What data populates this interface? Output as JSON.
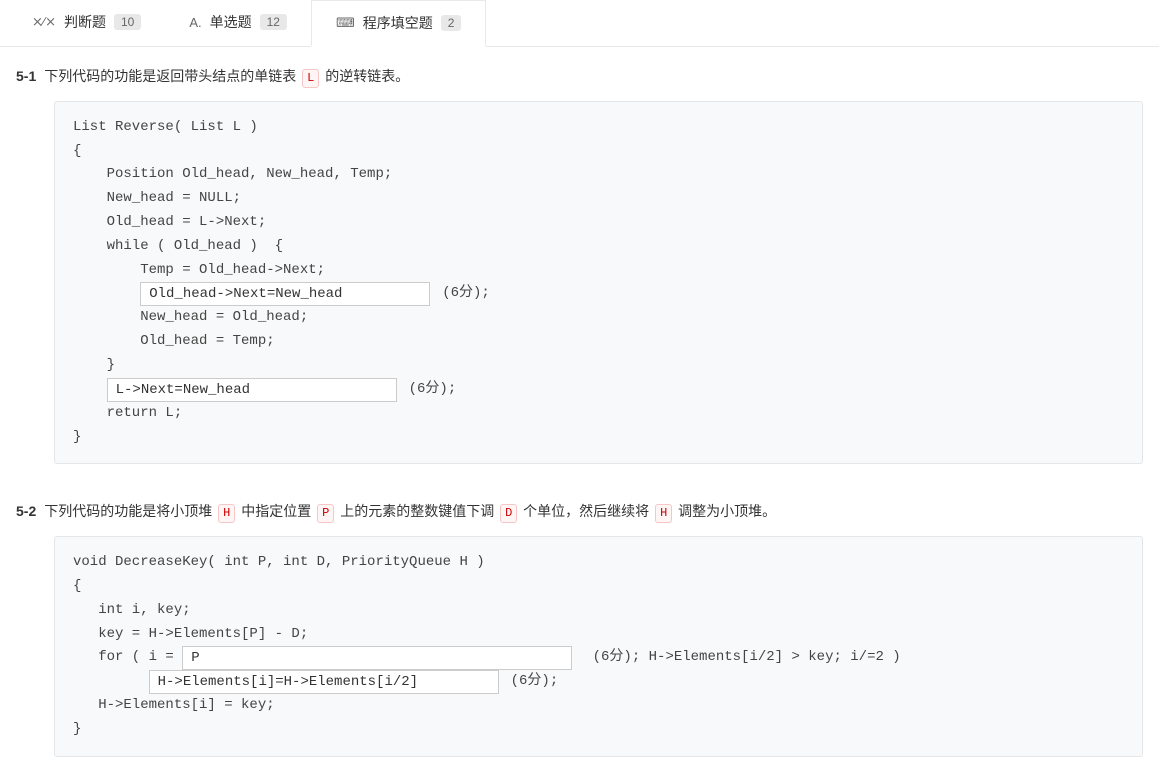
{
  "tabs": [
    {
      "icon": "⨯⁄⨯",
      "label": "判断题",
      "count": "10"
    },
    {
      "icon": "A.",
      "label": "单选题",
      "count": "12"
    },
    {
      "icon": "⌨",
      "label": "程序填空题",
      "count": "2"
    }
  ],
  "q1": {
    "num": "5-1",
    "text_parts": {
      "pre": "下列代码的功能是返回带头结点的单链表 ",
      "tag1": "L",
      "post": " 的逆转链表。"
    },
    "code": {
      "l1": "List Reverse( List L )",
      "l2": "{",
      "l3": "    Position Old_head, New_head, Temp;",
      "l4": "    New_head = NULL;",
      "l5": "    Old_head = L->Next;",
      "l6": "",
      "l7": "    while ( Old_head )  {",
      "l8": "        Temp = Old_head->Next;",
      "indent9": "        ",
      "blank1": "Old_head->Next=New_head",
      "score1": "(6分);",
      "l10": "        New_head = Old_head;",
      "l11": "        Old_head = Temp;",
      "l12": "    }",
      "indent13": "    ",
      "blank2": "L->Next=New_head",
      "score2": "(6分);",
      "l14": "    return L;",
      "l15": "}"
    }
  },
  "q2": {
    "num": "5-2",
    "text_parts": {
      "p1": "下列代码的功能是将小顶堆 ",
      "t1": "H",
      "p2": " 中指定位置 ",
      "t2": "P",
      "p3": " 上的元素的整数键值下调 ",
      "t3": "D",
      "p4": " 个单位，然后继续将 ",
      "t4": "H",
      "p5": " 调整为小顶堆。"
    },
    "code": {
      "l1": "void DecreaseKey( int P, int D, PriorityQueue H )",
      "l2": "{",
      "l3": "   int i, key;",
      "l4": "   key = H->Elements[P] - D;",
      "l5pre": "   for ( i = ",
      "blank1": "P",
      "score1": "(6分)",
      "l5post": "; H->Elements[i/2] > key; i/=2 )",
      "indent6": "         ",
      "blank2": "H->Elements[i]=H->Elements[i/2]",
      "score2": "(6分);",
      "l7": "   H->Elements[i] = key;",
      "l8": "}"
    }
  }
}
